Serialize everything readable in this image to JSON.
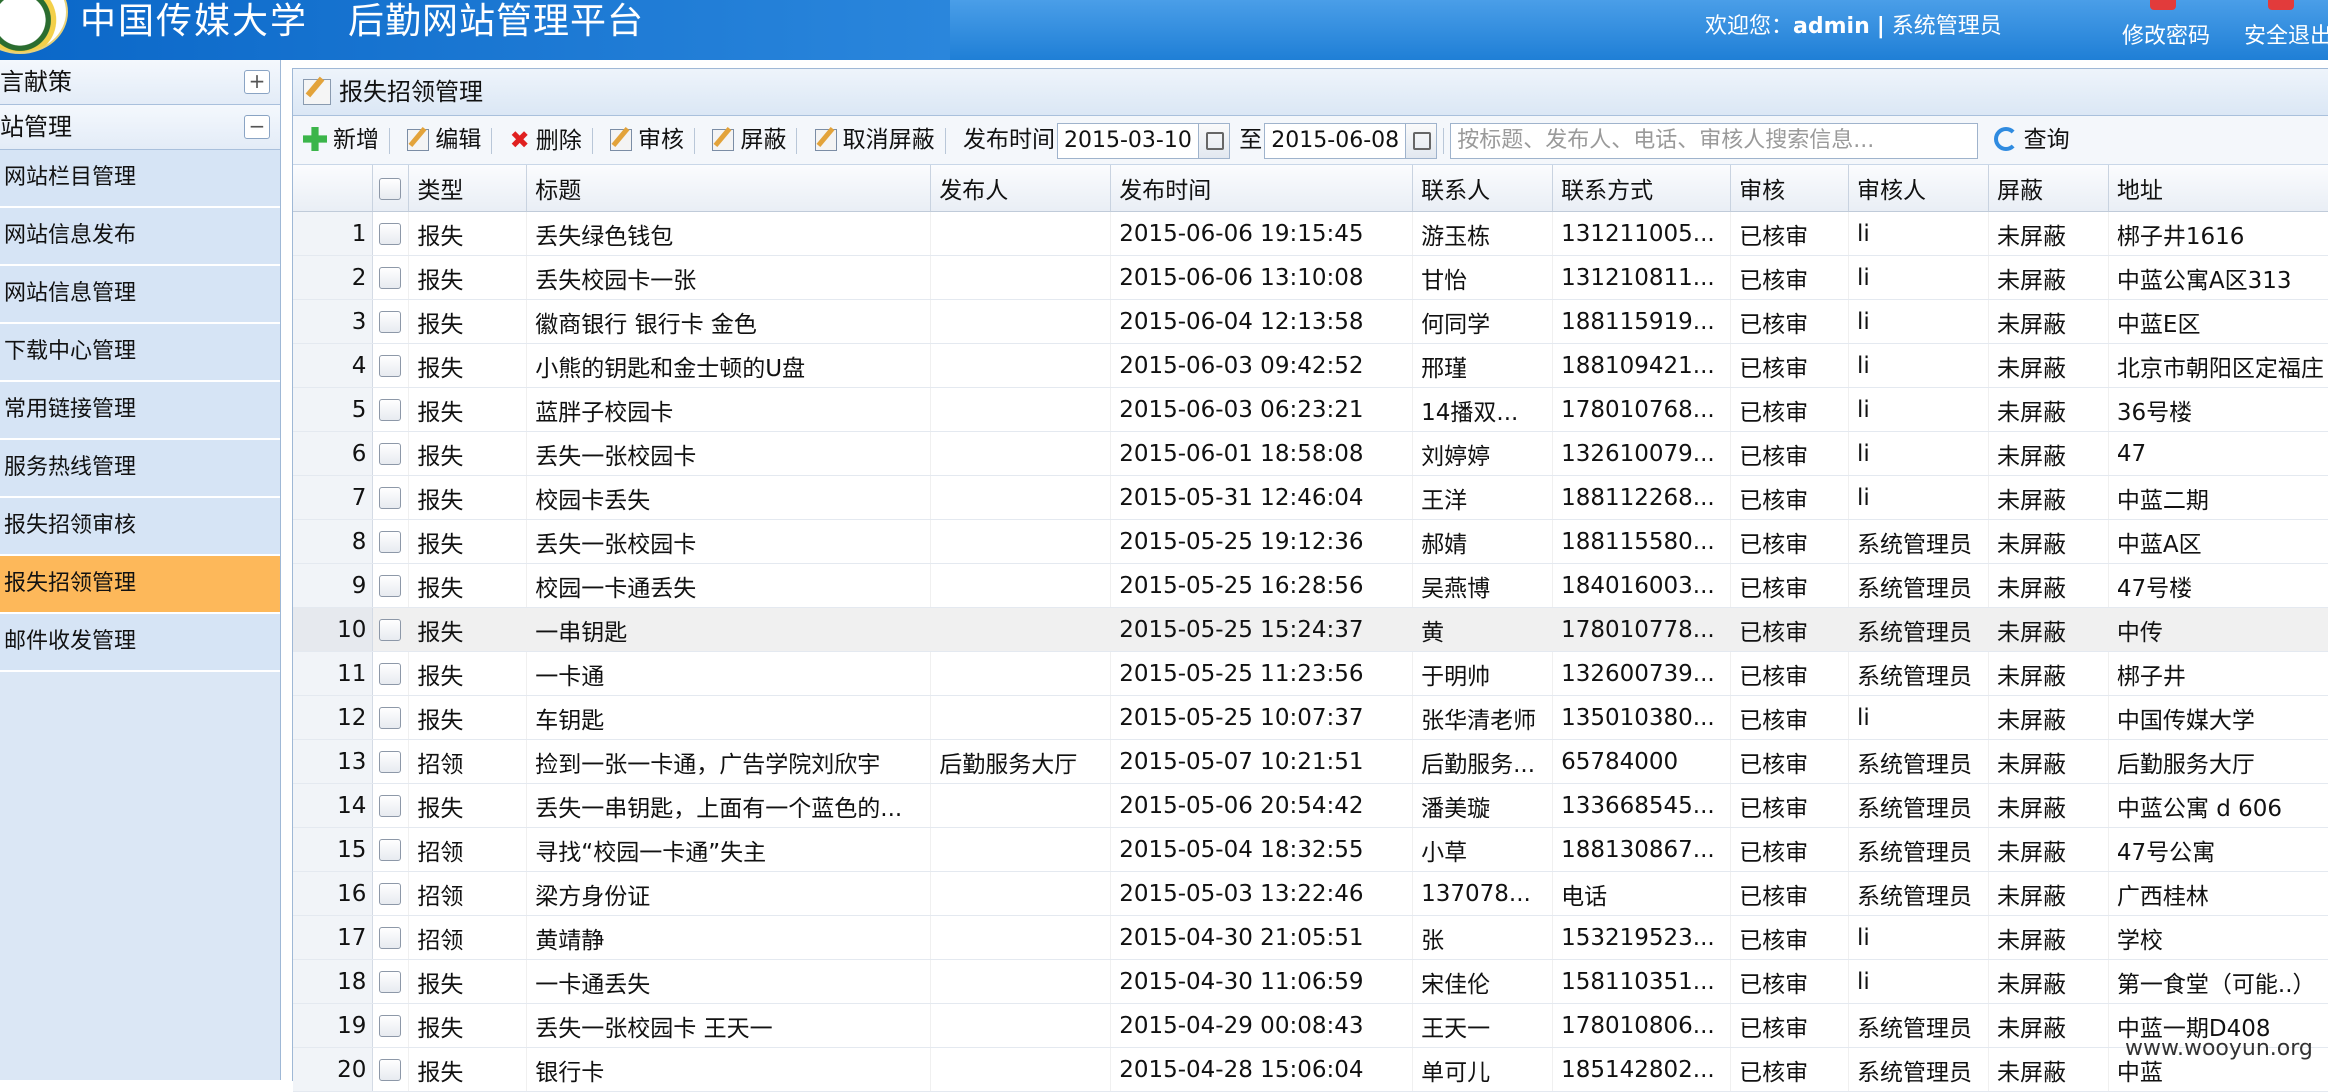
{
  "header": {
    "title_part1": "中国传媒大学",
    "title_part2": "后勤网站管理平台",
    "welcome_prefix": "欢迎您：",
    "username": "admin",
    "separator": "|",
    "role": "系统管理员",
    "change_password": "修改密码",
    "logout": "安全退出",
    "colors": {
      "bar": "#2386dc",
      "brand": "#0a67c8"
    }
  },
  "sidebar": {
    "groups": [
      {
        "label": "言献策",
        "toggle": "+"
      },
      {
        "label": "站管理",
        "toggle": "−"
      }
    ],
    "items": [
      {
        "label": "网站栏目管理"
      },
      {
        "label": "网站信息发布"
      },
      {
        "label": "网站信息管理"
      },
      {
        "label": "下载中心管理"
      },
      {
        "label": "常用链接管理"
      },
      {
        "label": "服务热线管理"
      },
      {
        "label": "报失招领审核"
      },
      {
        "label": "报失招领管理"
      },
      {
        "label": "邮件收发管理"
      }
    ],
    "active_index": 7,
    "active_color": "#fdb85a"
  },
  "panel": {
    "title": "报失招领管理"
  },
  "toolbar": {
    "add": "新增",
    "edit": "编辑",
    "delete": "删除",
    "review": "审核",
    "hide": "屏蔽",
    "unhide": "取消屏蔽",
    "date_label": "发布时间",
    "date_from": "2015-03-10",
    "date_to_label": "至",
    "date_to": "2015-06-08",
    "search_placeholder": "按标题、发布人、电话、审核人搜索信息...",
    "query": "查询"
  },
  "table": {
    "columns": [
      "类型",
      "标题",
      "发布人",
      "发布时间",
      "联系人",
      "联系方式",
      "审核",
      "审核人",
      "屏蔽",
      "地址"
    ],
    "selected_row": 10,
    "rows": [
      {
        "n": "1",
        "type": "报失",
        "title": "丢失绿色钱包",
        "publisher": "",
        "time": "2015-06-06 19:15:45",
        "contact": "游玉栋",
        "phone": "131211005...",
        "review": "已核审",
        "reviewer": "li",
        "hidden": "未屏蔽",
        "address": "梆子井1616"
      },
      {
        "n": "2",
        "type": "报失",
        "title": "丢失校园卡一张",
        "publisher": "",
        "time": "2015-06-06 13:10:08",
        "contact": "甘怡",
        "phone": "131210811...",
        "review": "已核审",
        "reviewer": "li",
        "hidden": "未屏蔽",
        "address": "中蓝公寓A区313"
      },
      {
        "n": "3",
        "type": "报失",
        "title": "徽商银行 银行卡 金色",
        "publisher": "",
        "time": "2015-06-04 12:13:58",
        "contact": "何同学",
        "phone": "188115919...",
        "review": "已核审",
        "reviewer": "li",
        "hidden": "未屏蔽",
        "address": "中蓝E区"
      },
      {
        "n": "4",
        "type": "报失",
        "title": "小熊的钥匙和金士顿的U盘",
        "publisher": "",
        "time": "2015-06-03 09:42:52",
        "contact": "邢瑾",
        "phone": "188109421...",
        "review": "已核审",
        "reviewer": "li",
        "hidden": "未屏蔽",
        "address": "北京市朝阳区定福庄"
      },
      {
        "n": "5",
        "type": "报失",
        "title": "蓝胖子校园卡",
        "publisher": "",
        "time": "2015-06-03 06:23:21",
        "contact": "14播双...",
        "phone": "178010768...",
        "review": "已核审",
        "reviewer": "li",
        "hidden": "未屏蔽",
        "address": "36号楼"
      },
      {
        "n": "6",
        "type": "报失",
        "title": "丢失一张校园卡",
        "publisher": "",
        "time": "2015-06-01 18:58:08",
        "contact": "刘婷婷",
        "phone": "132610079...",
        "review": "已核审",
        "reviewer": "li",
        "hidden": "未屏蔽",
        "address": "47"
      },
      {
        "n": "7",
        "type": "报失",
        "title": "校园卡丢失",
        "publisher": "",
        "time": "2015-05-31 12:46:04",
        "contact": "王洋",
        "phone": "188112268...",
        "review": "已核审",
        "reviewer": "li",
        "hidden": "未屏蔽",
        "address": "中蓝二期"
      },
      {
        "n": "8",
        "type": "报失",
        "title": "丢失一张校园卡",
        "publisher": "",
        "time": "2015-05-25 19:12:36",
        "contact": "郝婧",
        "phone": "188115580...",
        "review": "已核审",
        "reviewer": "系统管理员",
        "hidden": "未屏蔽",
        "address": "中蓝A区"
      },
      {
        "n": "9",
        "type": "报失",
        "title": "校园一卡通丢失",
        "publisher": "",
        "time": "2015-05-25 16:28:56",
        "contact": "吴燕博",
        "phone": "184016003...",
        "review": "已核审",
        "reviewer": "系统管理员",
        "hidden": "未屏蔽",
        "address": "47号楼"
      },
      {
        "n": "10",
        "type": "报失",
        "title": "一串钥匙",
        "publisher": "",
        "time": "2015-05-25 15:24:37",
        "contact": "黄",
        "phone": "178010778...",
        "review": "已核审",
        "reviewer": "系统管理员",
        "hidden": "未屏蔽",
        "address": "中传"
      },
      {
        "n": "11",
        "type": "报失",
        "title": "一卡通",
        "publisher": "",
        "time": "2015-05-25 11:23:56",
        "contact": "于明帅",
        "phone": "132600739...",
        "review": "已核审",
        "reviewer": "系统管理员",
        "hidden": "未屏蔽",
        "address": "梆子井"
      },
      {
        "n": "12",
        "type": "报失",
        "title": "车钥匙",
        "publisher": "",
        "time": "2015-05-25 10:07:37",
        "contact": "张华清老师",
        "phone": "135010380...",
        "review": "已核审",
        "reviewer": "li",
        "hidden": "未屏蔽",
        "address": "中国传媒大学"
      },
      {
        "n": "13",
        "type": "招领",
        "title": "捡到一张一卡通，广告学院刘欣宇",
        "publisher": "后勤服务大厅",
        "time": "2015-05-07 10:21:51",
        "contact": "后勤服务...",
        "phone": "65784000",
        "review": "已核审",
        "reviewer": "系统管理员",
        "hidden": "未屏蔽",
        "address": "后勤服务大厅"
      },
      {
        "n": "14",
        "type": "报失",
        "title": "丢失一串钥匙，上面有一个蓝色的...",
        "publisher": "",
        "time": "2015-05-06 20:54:42",
        "contact": "潘美璇",
        "phone": "133668545...",
        "review": "已核审",
        "reviewer": "系统管理员",
        "hidden": "未屏蔽",
        "address": "中蓝公寓 d 606"
      },
      {
        "n": "15",
        "type": "招领",
        "title": "寻找“校园一卡通”失主",
        "publisher": "",
        "time": "2015-05-04 18:32:55",
        "contact": "小草",
        "phone": "188130867...",
        "review": "已核审",
        "reviewer": "系统管理员",
        "hidden": "未屏蔽",
        "address": "47号公寓"
      },
      {
        "n": "16",
        "type": "招领",
        "title": "梁方身份证",
        "publisher": "",
        "time": "2015-05-03 13:22:46",
        "contact": "137078...",
        "phone": "电话",
        "review": "已核审",
        "reviewer": "系统管理员",
        "hidden": "未屏蔽",
        "address": "广西桂林"
      },
      {
        "n": "17",
        "type": "招领",
        "title": "黄靖静",
        "publisher": "",
        "time": "2015-04-30 21:05:51",
        "contact": "张",
        "phone": "153219523...",
        "review": "已核审",
        "reviewer": "li",
        "hidden": "未屏蔽",
        "address": "学校"
      },
      {
        "n": "18",
        "type": "报失",
        "title": "一卡通丢失",
        "publisher": "",
        "time": "2015-04-30 11:06:59",
        "contact": "宋佳伦",
        "phone": "158110351...",
        "review": "已核审",
        "reviewer": "li",
        "hidden": "未屏蔽",
        "address": "第一食堂（可能..）"
      },
      {
        "n": "19",
        "type": "报失",
        "title": "丢失一张校园卡 王天一",
        "publisher": "",
        "time": "2015-04-29 00:08:43",
        "contact": "王天一",
        "phone": "178010806...",
        "review": "已核审",
        "reviewer": "系统管理员",
        "hidden": "未屏蔽",
        "address": "中蓝一期D408"
      },
      {
        "n": "20",
        "type": "报失",
        "title": "银行卡",
        "publisher": "",
        "time": "2015-04-28 15:06:04",
        "contact": "单可儿",
        "phone": "185142802...",
        "review": "已核审",
        "reviewer": "系统管理员",
        "hidden": "未屏蔽",
        "address": "中蓝"
      }
    ]
  },
  "watermark": "www.wooyun.org"
}
